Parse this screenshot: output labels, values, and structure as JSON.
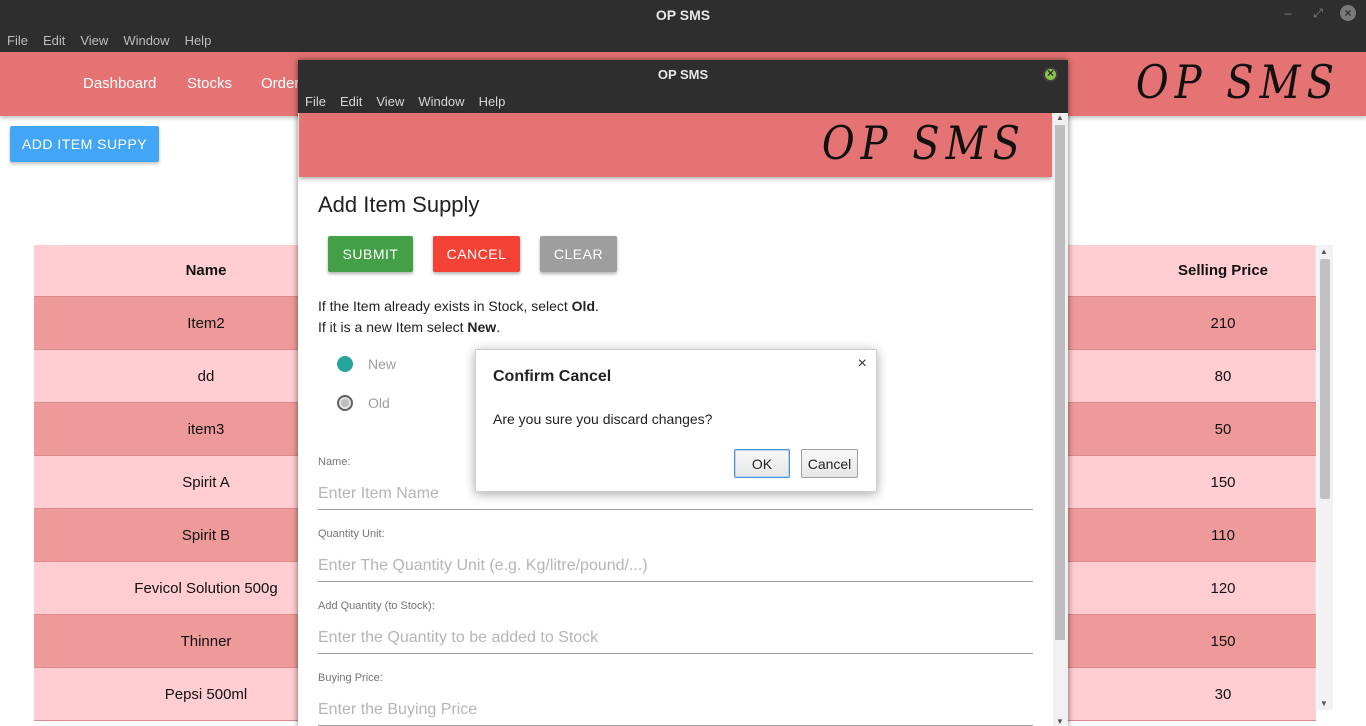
{
  "main_window": {
    "title": "OP SMS",
    "menu": [
      "File",
      "Edit",
      "View",
      "Window",
      "Help"
    ],
    "controls": {
      "minimize": "–",
      "maximize": "⤢",
      "close": "×"
    }
  },
  "app_nav": {
    "items": [
      "Dashboard",
      "Stocks",
      "Order"
    ],
    "logo": "OP SMS"
  },
  "add_supply_button": "ADD ITEM SUPPY",
  "stock_table": {
    "headers": {
      "name": "Name",
      "price": "Selling Price"
    },
    "rows": [
      {
        "name": "Item2",
        "price": "210"
      },
      {
        "name": "dd",
        "price": "80"
      },
      {
        "name": "item3",
        "price": "50"
      },
      {
        "name": "Spirit A",
        "price": "150"
      },
      {
        "name": "Spirit B",
        "price": "110"
      },
      {
        "name": "Fevicol Solution 500g",
        "price": "120"
      },
      {
        "name": "Thinner",
        "price": "150"
      },
      {
        "name": "Pepsi 500ml",
        "price": "30"
      }
    ]
  },
  "child_window": {
    "title": "OP SMS",
    "menu": [
      "File",
      "Edit",
      "View",
      "Window",
      "Help"
    ],
    "logo": "OP SMS",
    "form": {
      "title": "Add Item Supply",
      "buttons": {
        "submit": "SUBMIT",
        "cancel": "CANCEL",
        "clear": "CLEAR"
      },
      "instruction1": {
        "prefix": "If the Item already exists in Stock, select ",
        "bold": "Old",
        "suffix": "."
      },
      "instruction2": {
        "prefix": "If it is a new Item select ",
        "bold": "New",
        "suffix": "."
      },
      "radio_new": "New",
      "radio_old": "Old",
      "selected": "New",
      "fields": [
        {
          "label": "Name:",
          "placeholder": "Enter Item Name"
        },
        {
          "label": "Quantity Unit:",
          "placeholder": "Enter The Quantity Unit (e.g. Kg/litre/pound/...)"
        },
        {
          "label": "Add Quantity (to Stock):",
          "placeholder": "Enter the Quantity to be added to Stock"
        },
        {
          "label": "Buying Price:",
          "placeholder": "Enter the Buying Price"
        }
      ]
    }
  },
  "dialog": {
    "title": "Confirm Cancel",
    "close": "×",
    "message": "Are you sure you discard changes?",
    "ok": "OK",
    "cancel": "Cancel"
  },
  "colors": {
    "nav": "#e57373",
    "row_dark": "#ef9a9a",
    "row_light": "#ffcdd2",
    "add_button": "#42a5f5",
    "submit": "#43a047",
    "cancel": "#f44336",
    "clear": "#9e9e9e",
    "radio_selected": "#26a69a"
  }
}
